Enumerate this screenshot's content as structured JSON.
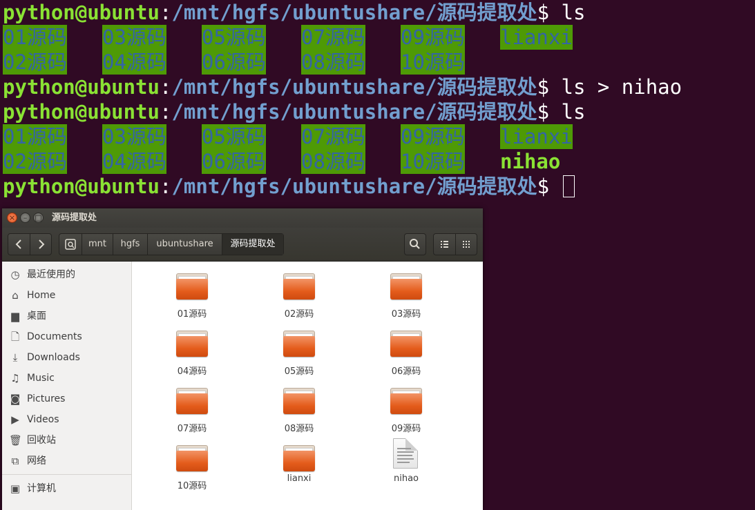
{
  "terminal": {
    "prompt": {
      "user": "python@ubuntu",
      "colon": ":",
      "path": "/mnt/hgfs/ubuntushare/源码提取处",
      "dollar": "$"
    },
    "commands": [
      "ls",
      "ls > nihao",
      "ls",
      ""
    ],
    "ls1": {
      "dirs": [
        "01源码",
        "03源码",
        "05源码",
        "07源码",
        "09源码",
        "lianxi",
        "02源码",
        "04源码",
        "06源码",
        "08源码",
        "10源码"
      ]
    },
    "ls2": {
      "dirs": [
        "01源码",
        "03源码",
        "05源码",
        "07源码",
        "09源码",
        "lianxi",
        "02源码",
        "04源码",
        "06源码",
        "08源码",
        "10源码"
      ],
      "file": "nihao"
    },
    "colors": {
      "background": "#300a24",
      "user": "#8ae234",
      "path": "#729fcf",
      "dir_bg": "#4e9a06",
      "dir_fg": "#3465a4"
    }
  },
  "file_manager": {
    "title": "源码提取处",
    "breadcrumbs": [
      "mnt",
      "hgfs",
      "ubuntushare",
      "源码提取处"
    ],
    "breadcrumb_root_icon": "drive-icon",
    "nav": {
      "back_icon": "chevron-left-icon",
      "forward_icon": "chevron-right-icon"
    },
    "toolbar_icons": {
      "search": "search-icon",
      "list": "list-view-icon",
      "grid": "grid-view-icon"
    },
    "sidebar": [
      {
        "label": "最近使用的",
        "icon": "clock-icon"
      },
      {
        "label": "Home",
        "icon": "home-icon"
      },
      {
        "label": "桌面",
        "icon": "desktop-folder-icon"
      },
      {
        "label": "Documents",
        "icon": "document-icon"
      },
      {
        "label": "Downloads",
        "icon": "download-icon"
      },
      {
        "label": "Music",
        "icon": "music-icon"
      },
      {
        "label": "Pictures",
        "icon": "camera-icon"
      },
      {
        "label": "Videos",
        "icon": "video-icon"
      },
      {
        "label": "回收站",
        "icon": "trash-icon"
      },
      {
        "label": "网络",
        "icon": "network-icon"
      },
      {
        "label": "计算机",
        "icon": "drive-icon"
      }
    ],
    "items": [
      {
        "name": "01源码",
        "type": "folder"
      },
      {
        "name": "02源码",
        "type": "folder"
      },
      {
        "name": "03源码",
        "type": "folder"
      },
      {
        "name": "04源码",
        "type": "folder"
      },
      {
        "name": "05源码",
        "type": "folder"
      },
      {
        "name": "06源码",
        "type": "folder"
      },
      {
        "name": "07源码",
        "type": "folder"
      },
      {
        "name": "08源码",
        "type": "folder"
      },
      {
        "name": "09源码",
        "type": "folder"
      },
      {
        "name": "10源码",
        "type": "folder"
      },
      {
        "name": "lianxi",
        "type": "folder"
      },
      {
        "name": "nihao",
        "type": "file"
      }
    ]
  }
}
